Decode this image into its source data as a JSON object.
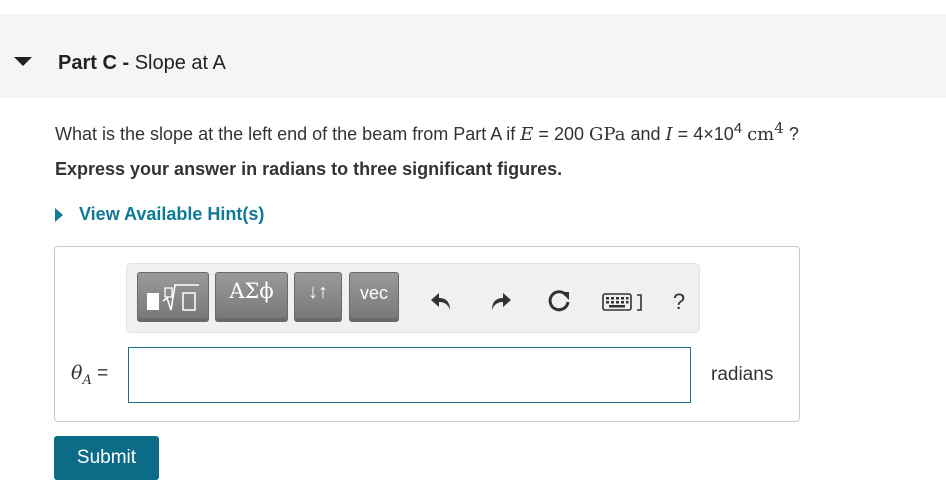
{
  "part": {
    "label": "Part C -",
    "title": "Slope at A"
  },
  "question": {
    "lead": "What is the slope at the left end of the beam from Part A if",
    "E_symbol": "E",
    "eq1": "=",
    "E_value": "200",
    "E_unit": "GPa",
    "and": "and",
    "I_symbol": "I",
    "eq2": "=",
    "I_value": "4×10",
    "I_exp": "4",
    "I_unit": "cm",
    "I_unit_exp": "4",
    "end": "?"
  },
  "instruction": "Express your answer in radians to three significant figures.",
  "hint": {
    "label": "View Available Hint(s)"
  },
  "toolbar": {
    "templates_icon": "fraction-sqrt-icon",
    "greek_label": "ΑΣϕ",
    "arrows_label": "↓↑",
    "vec_label": "vec",
    "help_label": "?"
  },
  "answer": {
    "variable": "θ",
    "subscript": "A",
    "equals": "=",
    "value": "",
    "units": "radians"
  },
  "submit": {
    "label": "Submit"
  },
  "colors": {
    "header_bg": "#f5f5f5",
    "link": "#0f7a96",
    "submit_bg": "#0c6b87",
    "toolbar_button": "#888888"
  }
}
